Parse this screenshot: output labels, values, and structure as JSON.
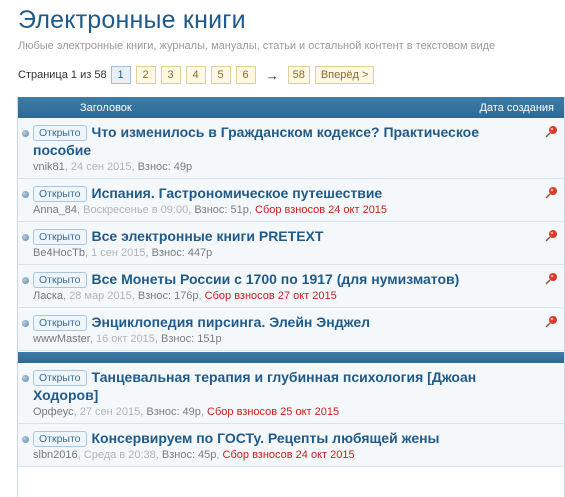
{
  "page": {
    "title": "Электронные книги",
    "subtitle": "Любые электронные книги, журналы, мануалы, статьи и остальной контент в текстовом виде"
  },
  "pager": {
    "label": "Страница 1 из 58",
    "pages": [
      "1",
      "2",
      "3",
      "4",
      "5",
      "6"
    ],
    "current": "1",
    "arrow": "→",
    "last": "58",
    "next": "Вперёд >"
  },
  "table": {
    "col_title": "Заголовок",
    "col_date": "Дата создания"
  },
  "pinned_topics": [
    {
      "status": "Открыто",
      "title": "Что изменилось в Гражданском кодексе? Практическое пособие",
      "author": "vnik81",
      "date": "24 сен 2015",
      "donation": "Взнос: 49р",
      "collect": ""
    },
    {
      "status": "Открыто",
      "title": "Испания. Гастрономическое путешествие",
      "author": "Anna_84",
      "date": "Воскресенье в 09:00",
      "donation": "Взнос: 51р",
      "collect": "Сбор взносов 24 окт 2015"
    },
    {
      "status": "Открыто",
      "title": "Все электронные книги PRETEXT",
      "author": "Be4HocTb",
      "date": "1 сен 2015",
      "donation": "Взнос: 447р",
      "collect": ""
    },
    {
      "status": "Открыто",
      "title": "Все Монеты России с 1700 по 1917 (для нумизматов)",
      "author": "Ласка",
      "date": "28 мар 2015",
      "donation": "Взнос: 176р",
      "collect": "Сбор взносов 27 окт 2015"
    },
    {
      "status": "Открыто",
      "title": "Энциклопедия пирсинга. Элейн Энджел",
      "author": "wwwMaster",
      "date": "16 окт 2015",
      "donation": "Взнос: 151р",
      "collect": ""
    }
  ],
  "topics": [
    {
      "status": "Открыто",
      "title": "Танцевальная терапия и глубинная психология [Джоан Ходоров]",
      "author": "Орфеус",
      "date": "27 сен 2015",
      "donation": "Взнос: 49р",
      "collect": "Сбор взносов 25 окт 2015"
    },
    {
      "status": "Открыто",
      "title": "Консервируем по ГОСТу. Рецепты любящей жены",
      "author": "slbn2016",
      "date": "Среда в 20:38",
      "donation": "Взнос: 45р",
      "collect": "Сбор взносов 24 окт 2015"
    }
  ],
  "icons": {
    "bullet": "bullet-icon",
    "pin": "pin-icon"
  },
  "colors": {
    "header_bg": "#2e6993",
    "title_link": "#1f5a8a",
    "collect_text": "#c81e1e"
  }
}
